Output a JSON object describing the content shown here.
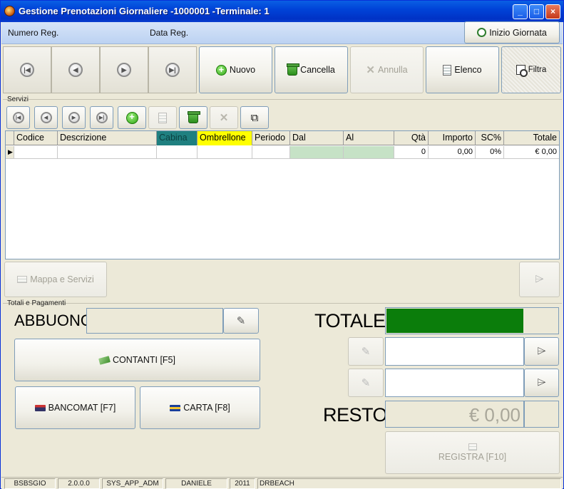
{
  "window": {
    "title": "Gestione Prenotazioni Giornaliere -1000001 -Terminale: 1"
  },
  "header": {
    "numero_reg_label": "Numero Reg.",
    "data_reg_label": "Data Reg.",
    "inizio_giornata_label": "Inizio Giornata"
  },
  "toolbar": {
    "nuovo_label": "Nuovo",
    "cancella_label": "Cancella",
    "annulla_label": "Annulla",
    "elenco_label": "Elenco",
    "filtra_label": "Filtra"
  },
  "servizi": {
    "group_label": "Servizi",
    "columns": [
      "Codice",
      "Descrizione",
      "Cabina",
      "Ombrellone",
      "Periodo",
      "Dal",
      "Al",
      "Qtà",
      "Importo",
      "SC%",
      "Totale"
    ],
    "rows": [
      {
        "codice": "",
        "descrizione": "",
        "cabina": "",
        "ombrellone": "",
        "periodo": "",
        "dal": "",
        "al": "",
        "qta": "0",
        "importo": "0,00",
        "sc": "0%",
        "totale": "€ 0,00"
      }
    ],
    "mappa_label": "Mappa e Servizi"
  },
  "totali": {
    "group_label": "Totali e Pagamenti",
    "abbuono_label": "ABBUONO",
    "totale_label": "TOTALE",
    "resto_label": "RESTO",
    "resto_value": "€ 0,00",
    "contanti_label": "CONTANTI [F5]",
    "bancomat_label": "BANCOMAT [F7]",
    "carta_label": "CARTA [F8]",
    "registra_label": "REGISTRA [F10]"
  },
  "statusbar": {
    "items": [
      "BSBSGIO",
      "2.0.0.0",
      "SYS_APP_ADM",
      "DANIELE",
      "2011",
      "DRBEACH"
    ]
  },
  "colors": {
    "totale_fill": "#0b7d0b",
    "cabina_header": "#1f8080",
    "ombrellone_header": "#ffff00",
    "date_cell": "#c6e2c6",
    "titlebar": "#0043d8"
  }
}
